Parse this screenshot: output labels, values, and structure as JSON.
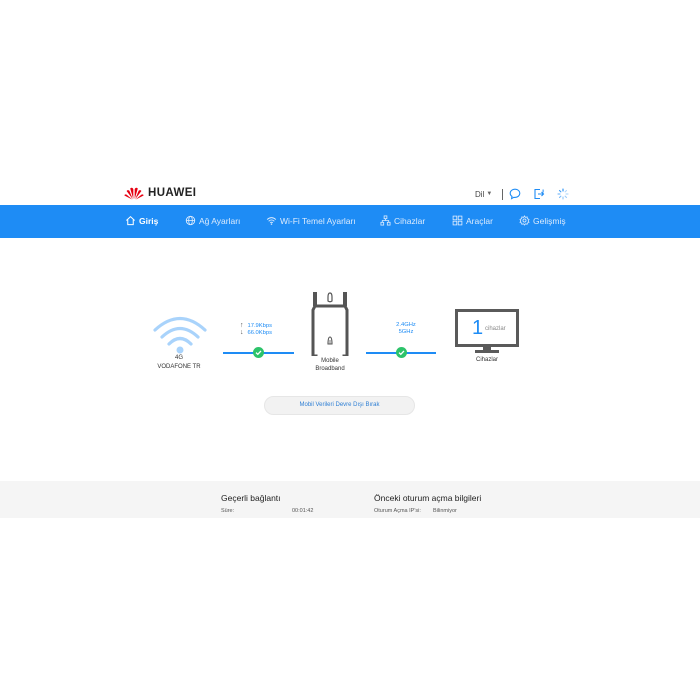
{
  "header": {
    "brand": "HUAWEI",
    "brand_color": "#e60012",
    "language_label": "Dil",
    "icons": [
      "chat-icon",
      "logout-icon",
      "loading-icon"
    ]
  },
  "nav": {
    "accent": "#1e8cf5",
    "items": [
      {
        "label": "Giriş",
        "icon": "home-icon",
        "active": true
      },
      {
        "label": "Ağ Ayarları",
        "icon": "globe-icon",
        "active": false
      },
      {
        "label": "Wi-Fi Temel Ayarları",
        "icon": "wifi-icon",
        "active": false
      },
      {
        "label": "Cihazlar",
        "icon": "topology-icon",
        "active": false
      },
      {
        "label": "Araçlar",
        "icon": "tools-icon",
        "active": false
      },
      {
        "label": "Gelişmiş",
        "icon": "gear-icon",
        "active": false
      }
    ]
  },
  "status": {
    "network_type": "4G",
    "operator": "VODAFONE TR",
    "upload_rate": "17.9Kbps",
    "download_rate": "66.0Kbps",
    "router_label_line1": "Mobile",
    "router_label_line2": "Broadband",
    "band_24": "2.4GHz",
    "band_5": "5GHz",
    "device_count": "1",
    "device_unit": "cihazlar",
    "devices_label": "Cihazlar",
    "status_ok_color": "#2dc36a"
  },
  "actions": {
    "disable_mobile_data": "Mobil Verileri Devre Dışı Bırak"
  },
  "current_connection": {
    "title": "Geçerli bağlantı",
    "duration_label": "Süre:",
    "duration_value": "00:01:42"
  },
  "previous_login": {
    "title": "Önceki oturum açma bilgileri",
    "ip_label": "Oturum Açma IP'si:",
    "ip_value": "Bilinmiyor"
  }
}
